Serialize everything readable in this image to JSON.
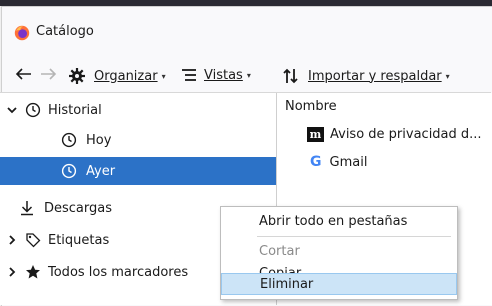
{
  "window": {
    "title": "Catálogo"
  },
  "toolbar": {
    "organize_label": "Organizar",
    "views_label": "Vistas",
    "import_label": "Importar y respaldar"
  },
  "tree": {
    "history": "Historial",
    "today": "Hoy",
    "yesterday": "Ayer",
    "downloads": "Descargas",
    "tags": "Etiquetas",
    "all_bookmarks": "Todos los marcadores"
  },
  "list": {
    "column_name": "Nombre",
    "rows": [
      {
        "title": "Aviso de privacidad d...",
        "icon": "m-site-icon"
      },
      {
        "title": "Gmail",
        "icon": "google-icon"
      }
    ]
  },
  "context_menu": {
    "open_all": "Abrir todo en pestañas",
    "cut": "Cortar",
    "copy": "Copiar",
    "delete": "Eliminar"
  },
  "colors": {
    "selection": "#2c72c7",
    "menu_hover": "#cce4f7"
  }
}
